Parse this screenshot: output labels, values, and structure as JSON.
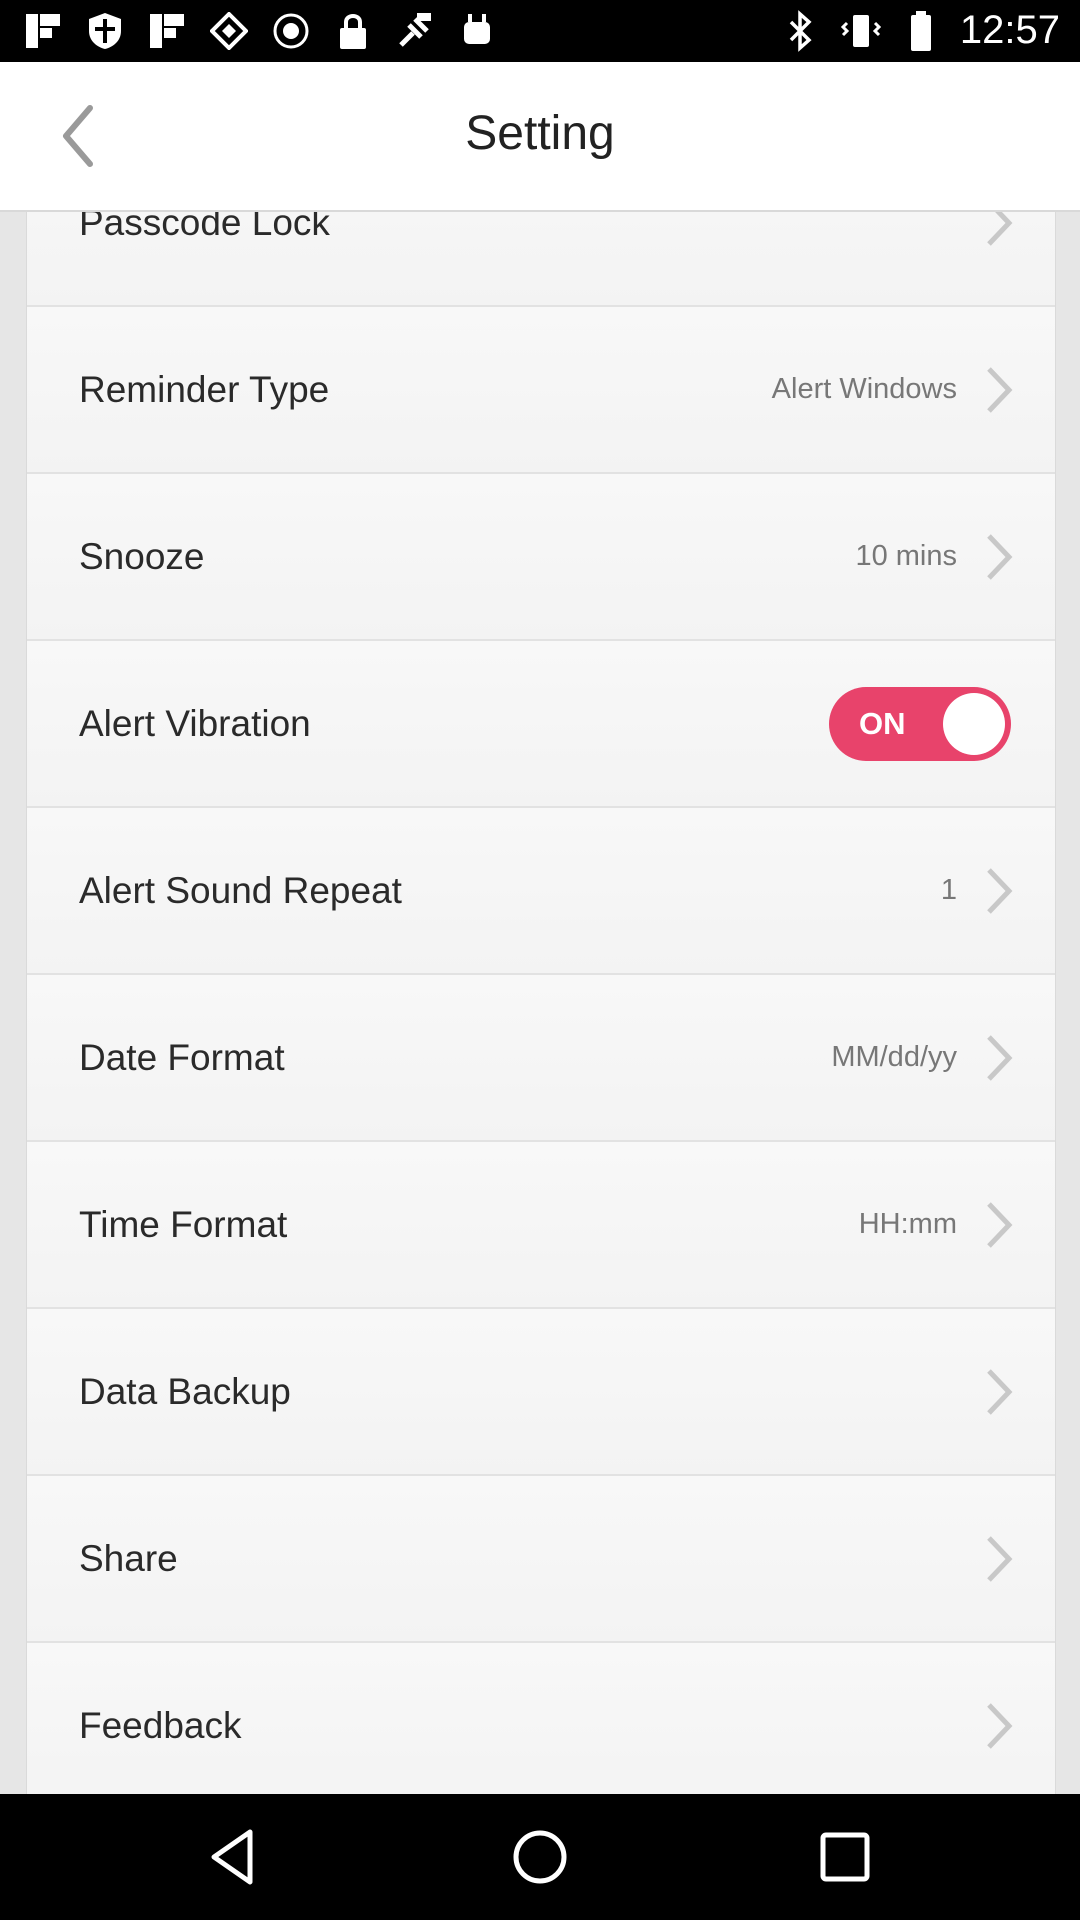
{
  "status_bar": {
    "time": "12:57",
    "left_icons": [
      "flipboard-icon",
      "shield-icon",
      "flipboard-icon",
      "diamond-icon",
      "record-icon",
      "lock-icon",
      "fake-gps-icon",
      "android-icon"
    ],
    "right_icons": [
      "bluetooth-icon",
      "vibrate-icon",
      "battery-icon"
    ]
  },
  "header": {
    "title": "Setting",
    "back_icon": "chevron-left-icon"
  },
  "settings": {
    "items": [
      {
        "label": "Passcode Lock",
        "value": "",
        "type": "link"
      },
      {
        "label": "Reminder Type",
        "value": "Alert Windows",
        "type": "link"
      },
      {
        "label": "Snooze",
        "value": "10 mins",
        "type": "link"
      },
      {
        "label": "Alert Vibration",
        "value": "ON",
        "type": "toggle"
      },
      {
        "label": "Alert Sound Repeat",
        "value": "1",
        "type": "link"
      },
      {
        "label": "Date Format",
        "value": "MM/dd/yy",
        "type": "link"
      },
      {
        "label": "Time Format",
        "value": "HH:mm",
        "type": "link"
      },
      {
        "label": "Data Backup",
        "value": "",
        "type": "link"
      },
      {
        "label": "Share",
        "value": "",
        "type": "link"
      },
      {
        "label": "Feedback",
        "value": "",
        "type": "link"
      }
    ]
  },
  "colors": {
    "toggle_on": "#e8436b",
    "header_bg": "#ffffff",
    "row_bg": "#f6f6f6"
  },
  "nav_bar": {
    "icons": [
      "back-triangle-icon",
      "home-circle-icon",
      "recents-square-icon"
    ]
  }
}
